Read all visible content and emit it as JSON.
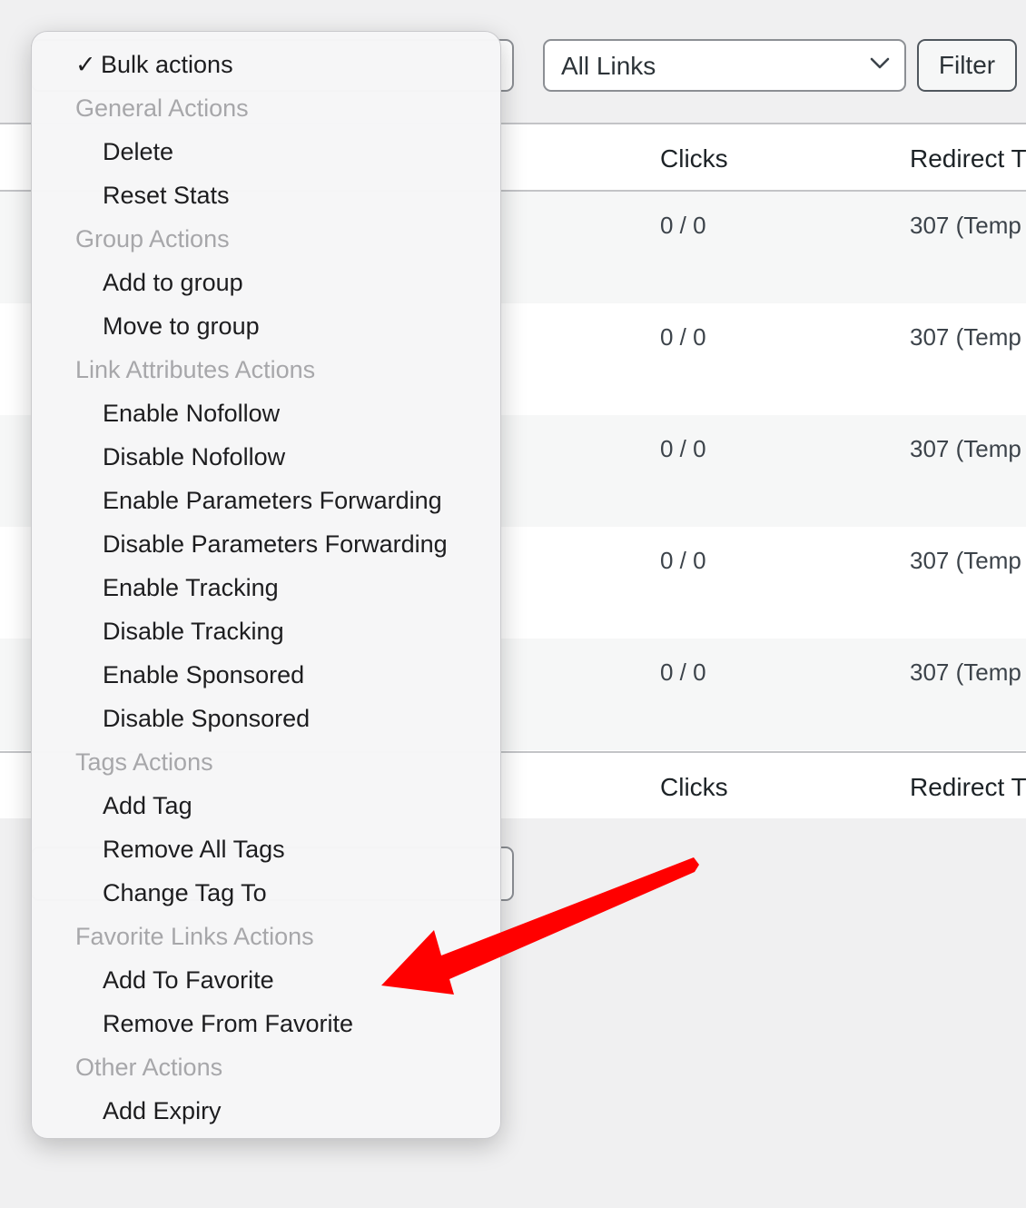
{
  "toolbar": {
    "links_filter_value": "All Links",
    "filter_label": "Filter"
  },
  "table": {
    "columns": {
      "clicks": "Clicks",
      "redirect": "Redirect T"
    },
    "rows": [
      {
        "clicks": "0 / 0",
        "redirect": "307 (Temp"
      },
      {
        "clicks": "0 / 0",
        "redirect": "307 (Temp"
      },
      {
        "clicks": "0 / 0",
        "redirect": "307 (Temp"
      },
      {
        "clicks": "0 / 0",
        "redirect": "307 (Temp"
      },
      {
        "clicks": "0 / 0",
        "redirect": "307 (Temp"
      }
    ]
  },
  "bulk_menu": {
    "checkmark": "✓",
    "selected": "Bulk actions",
    "groups": {
      "general": "General Actions",
      "group": "Group Actions",
      "link_attributes": "Link Attributes Actions",
      "tags": "Tags Actions",
      "favorite": "Favorite Links Actions",
      "other": "Other Actions"
    },
    "options": {
      "delete": "Delete",
      "reset_stats": "Reset Stats",
      "add_to_group": "Add to group",
      "move_to_group": "Move to group",
      "enable_nofollow": "Enable Nofollow",
      "disable_nofollow": "Disable Nofollow",
      "enable_params": "Enable Parameters Forwarding",
      "disable_params": "Disable Parameters Forwarding",
      "enable_tracking": "Enable Tracking",
      "disable_tracking": "Disable Tracking",
      "enable_sponsored": "Enable Sponsored",
      "disable_sponsored": "Disable Sponsored",
      "add_tag": "Add Tag",
      "remove_all_tags": "Remove All Tags",
      "change_tag_to": "Change Tag To",
      "add_to_favorite": "Add To Favorite",
      "remove_from_favorite": "Remove From Favorite",
      "add_expiry": "Add Expiry"
    }
  },
  "colors": {
    "annotation_arrow": "#ff0000",
    "group_label": "#a7a7aa",
    "menu_background": "#f6f6f7"
  },
  "icons": {
    "select_arrow": "chevron-down-icon",
    "annotation": "red-arrow-icon"
  }
}
